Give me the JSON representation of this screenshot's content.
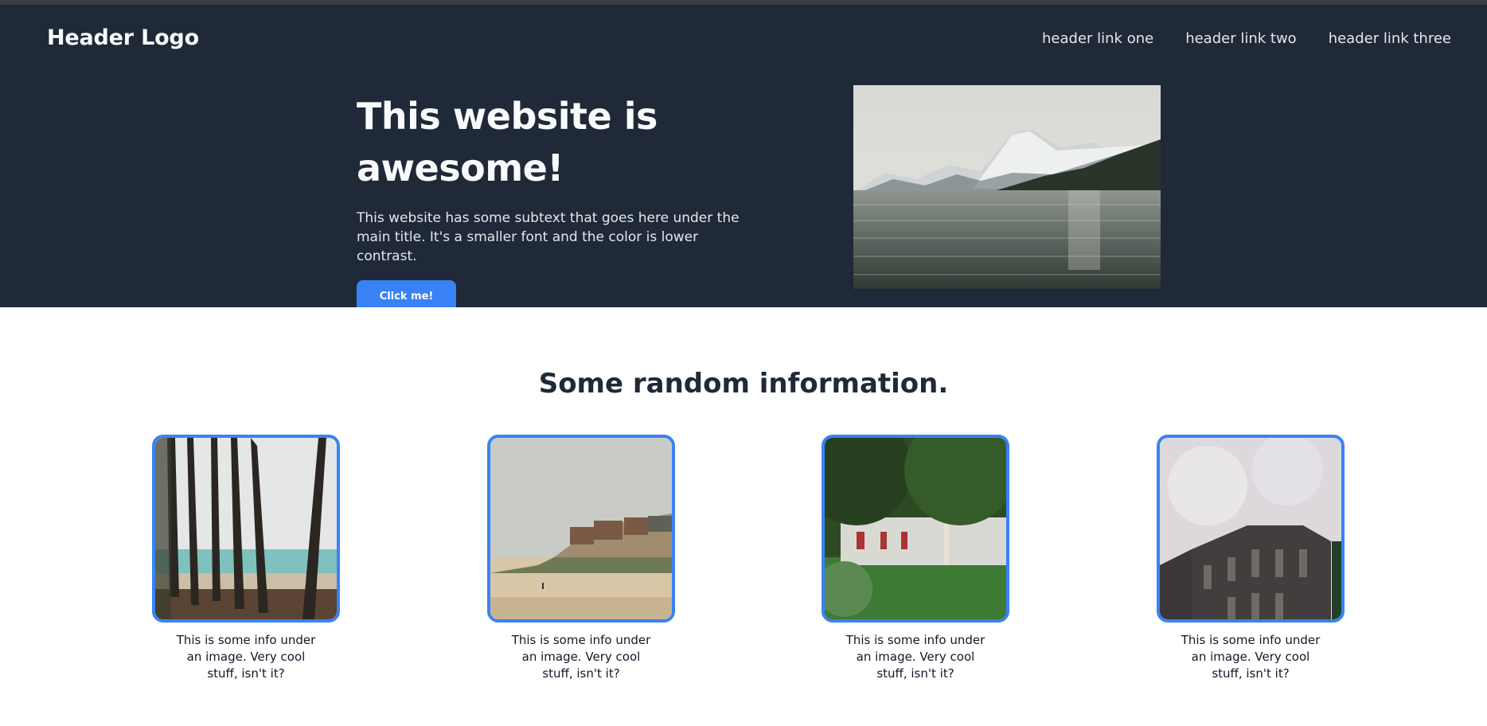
{
  "header": {
    "logo": "Header Logo",
    "links": [
      "header link one",
      "header link two",
      "header link three"
    ]
  },
  "hero": {
    "title": "This website is awesome!",
    "subtext": "This website has some subtext that goes here under the main title. It's a smaller font and the color is lower contrast.",
    "button_label": "Click me!",
    "image_icon": "mountain-lake-photo"
  },
  "info": {
    "title": "Some random information.",
    "cards": [
      {
        "text": "This is some info under an image. Very cool stuff, isn't it?",
        "image_icon": "palm-beach-photo"
      },
      {
        "text": "This is some info under an image. Very cool stuff, isn't it?",
        "image_icon": "coastal-cliff-photo"
      },
      {
        "text": "This is some info under an image. Very cool stuff, isn't it?",
        "image_icon": "park-trees-photo"
      },
      {
        "text": "This is some info under an image. Very cool stuff, isn't it?",
        "image_icon": "building-sky-photo"
      }
    ]
  },
  "colors": {
    "header_bg": "#1f2937",
    "accent": "#3882f6",
    "text_dark": "#1f2937"
  }
}
